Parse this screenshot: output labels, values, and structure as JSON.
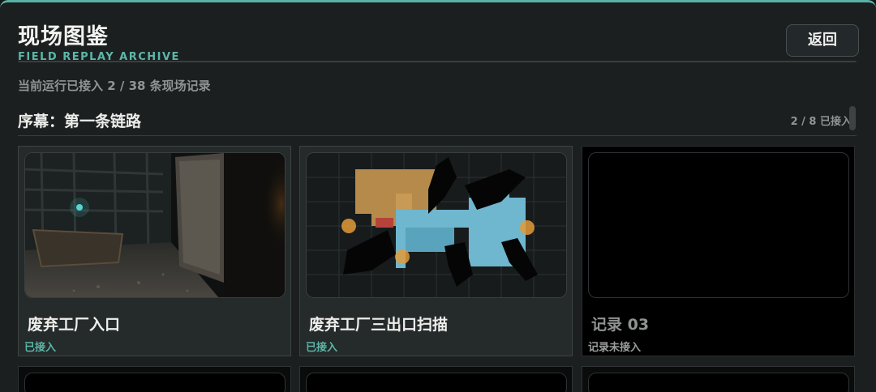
{
  "header": {
    "title": "现场图鉴",
    "subtitle": "FIELD REPLAY ARCHIVE",
    "back_label": "返回"
  },
  "progress_text": "当前运行已接入 2 / 38 条现场记录",
  "section": {
    "title": "序幕：第一条链路",
    "count": "2 / 8 已接入"
  },
  "cards": [
    {
      "title": "废弃工厂入口",
      "status": "已接入",
      "unlocked": true
    },
    {
      "title": "废弃工厂三出口扫描",
      "status": "已接入",
      "unlocked": true
    },
    {
      "title": "记录 03",
      "status": "记录未接入",
      "unlocked": false
    }
  ],
  "colors": {
    "accent": "#5bb7a8",
    "panel": "#1b1f20",
    "map_blue": "#6fb6cf",
    "map_orange": "#c89a55"
  }
}
